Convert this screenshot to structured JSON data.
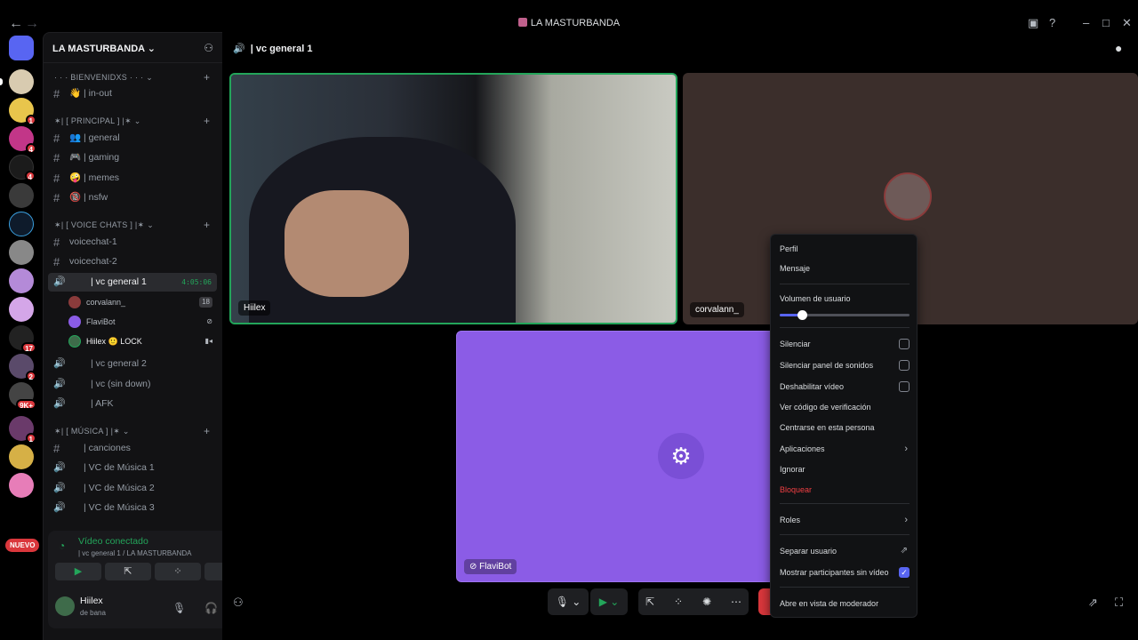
{
  "window": {
    "title": "LA MASTURBANDA"
  },
  "guilds": {
    "badges": [
      "1",
      "4",
      "4",
      "17",
      "2",
      "9K+",
      "1"
    ],
    "nuevo": "NUEVO"
  },
  "server": {
    "name": "LA MASTURBANDA ⌄"
  },
  "categories": {
    "bienvenidos": "· · · BIENVENIDXS · · · ⌄",
    "principal": "✶| [ PRINCIPAL ] |✶ ⌄",
    "voice": "✶| [ VOICE CHATS ] |✶ ⌄",
    "musica": "✶| [ MÚSICA ] |✶ ⌄"
  },
  "channels": {
    "inout": "👋 | in-out",
    "general": "👥 | general",
    "gaming": "🎮 | gaming",
    "memes": "🤪 | memes",
    "nsfw": "🔞 | nsfw",
    "voicechat1": "voicechat-1",
    "voicechat2": "voicechat-2",
    "vcgeneral1": "| vc general 1",
    "timer": "4:05:06",
    "vcgeneral2": "| vc general 2",
    "vcsindown": "| vc (sin down)",
    "afk": "|  AFK",
    "canciones": "| canciones",
    "musica1": "| VC de Música 1",
    "musica2": "| VC de Música 2",
    "musica3": "| VC de Música 3"
  },
  "members": [
    {
      "name": "corvalann_",
      "extra": "18"
    },
    {
      "name": "FlaviBot",
      "extra": ""
    },
    {
      "name": "Hiilex 🙂 LOCK",
      "extra": ""
    }
  ],
  "voice_panel": {
    "status": "Vídeo conectado",
    "sub": "| vc general 1 / LA MASTURBANDA"
  },
  "user": {
    "name": "Hiilex",
    "status": "de bana"
  },
  "vc_header": "| vc general 1",
  "tiles": {
    "hiilex": "Hiilex",
    "corvalann": "corvalann_",
    "flavibot": "FlaviBot"
  },
  "context_menu": {
    "perfil": "Perfil",
    "mensaje": "Mensaje",
    "volumen": "Volumen de usuario",
    "volume_level": 0.17,
    "silenciar": "Silenciar",
    "silenciar_sonidos": "Silenciar panel de sonidos",
    "deshabilitar": "Deshabilitar vídeo",
    "verificacion": "Ver código de verificación",
    "centrarse": "Centrarse en esta persona",
    "aplicaciones": "Aplicaciones",
    "ignorar": "Ignorar",
    "bloquear": "Bloquear",
    "roles": "Roles",
    "separar": "Separar usuario",
    "mostrar": "Mostrar participantes sin vídeo",
    "moderador": "Abre en vista de moderador"
  },
  "colors": {
    "accent": "#5865f2",
    "connected": "#23a55a",
    "danger": "#f23f43",
    "bot_tile": "#8b5ce6"
  }
}
